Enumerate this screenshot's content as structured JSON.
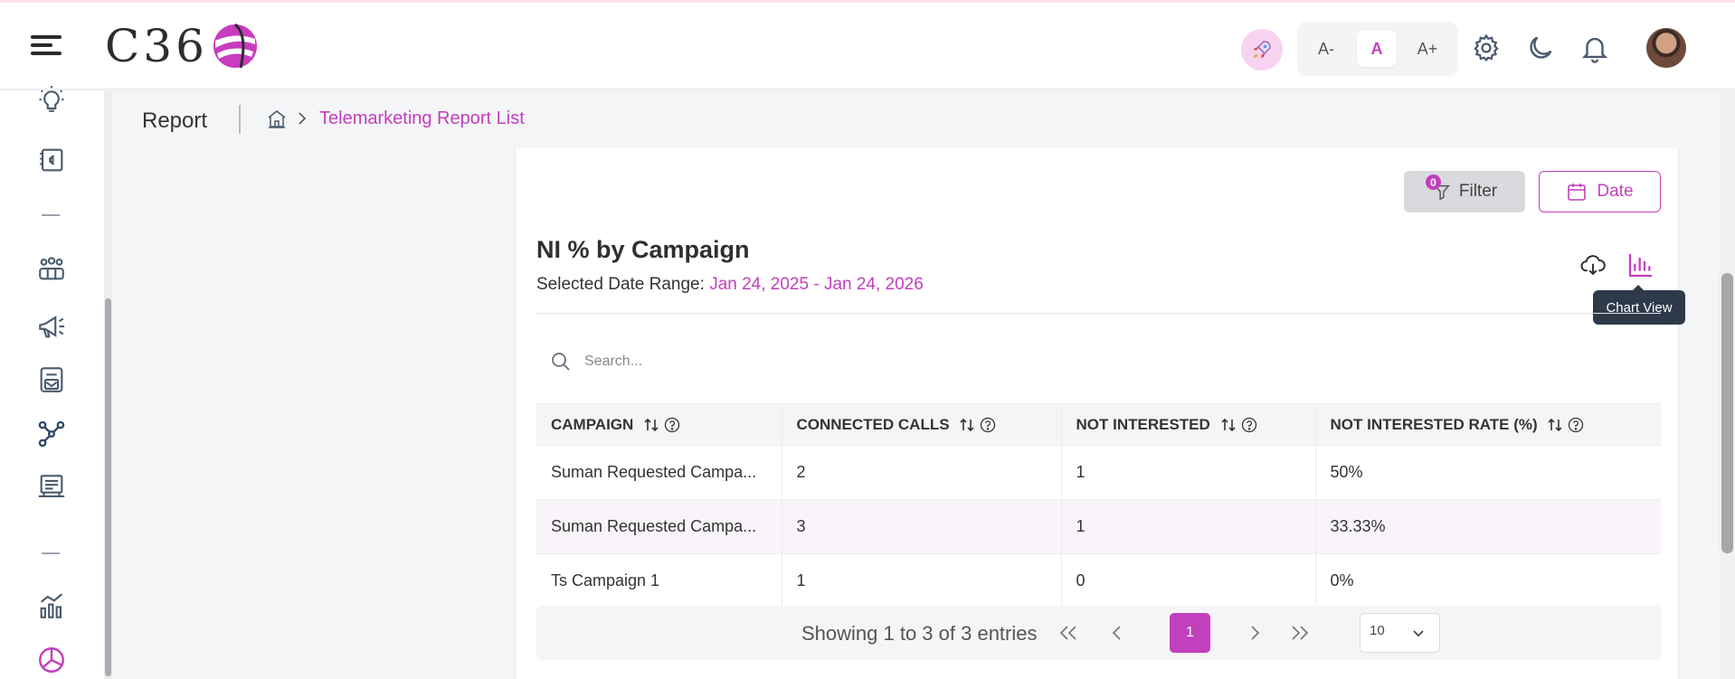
{
  "header": {
    "logo_text": "C36",
    "font_buttons": [
      "A-",
      "A",
      "A+"
    ]
  },
  "page": {
    "title": "Report",
    "breadcrumb": "Telemarketing Report List"
  },
  "toolbar": {
    "filter_label": "Filter",
    "filter_count": "0",
    "date_label": "Date"
  },
  "report": {
    "title": "NI % by Campaign",
    "date_range_label": "Selected Date Range:",
    "date_range_value": "Jan 24, 2025 - Jan 24, 2026",
    "tooltip": "Chart View"
  },
  "search": {
    "placeholder": "Search..."
  },
  "table": {
    "columns": [
      "CAMPAIGN",
      "CONNECTED CALLS",
      "NOT INTERESTED",
      "NOT INTERESTED RATE (%)"
    ],
    "rows": [
      [
        "Suman Requested Campa...",
        "2",
        "1",
        "50%"
      ],
      [
        "Suman Requested Campa...",
        "3",
        "1",
        "33.33%"
      ],
      [
        "Ts Campaign 1",
        "1",
        "0",
        "0%"
      ]
    ]
  },
  "pagination": {
    "info": "Showing 1 to 3 of 3 entries",
    "current_page": "1",
    "page_size": "10"
  },
  "colors": {
    "accent": "#c23fbd",
    "tooltip_bg": "#2e3a4a"
  }
}
